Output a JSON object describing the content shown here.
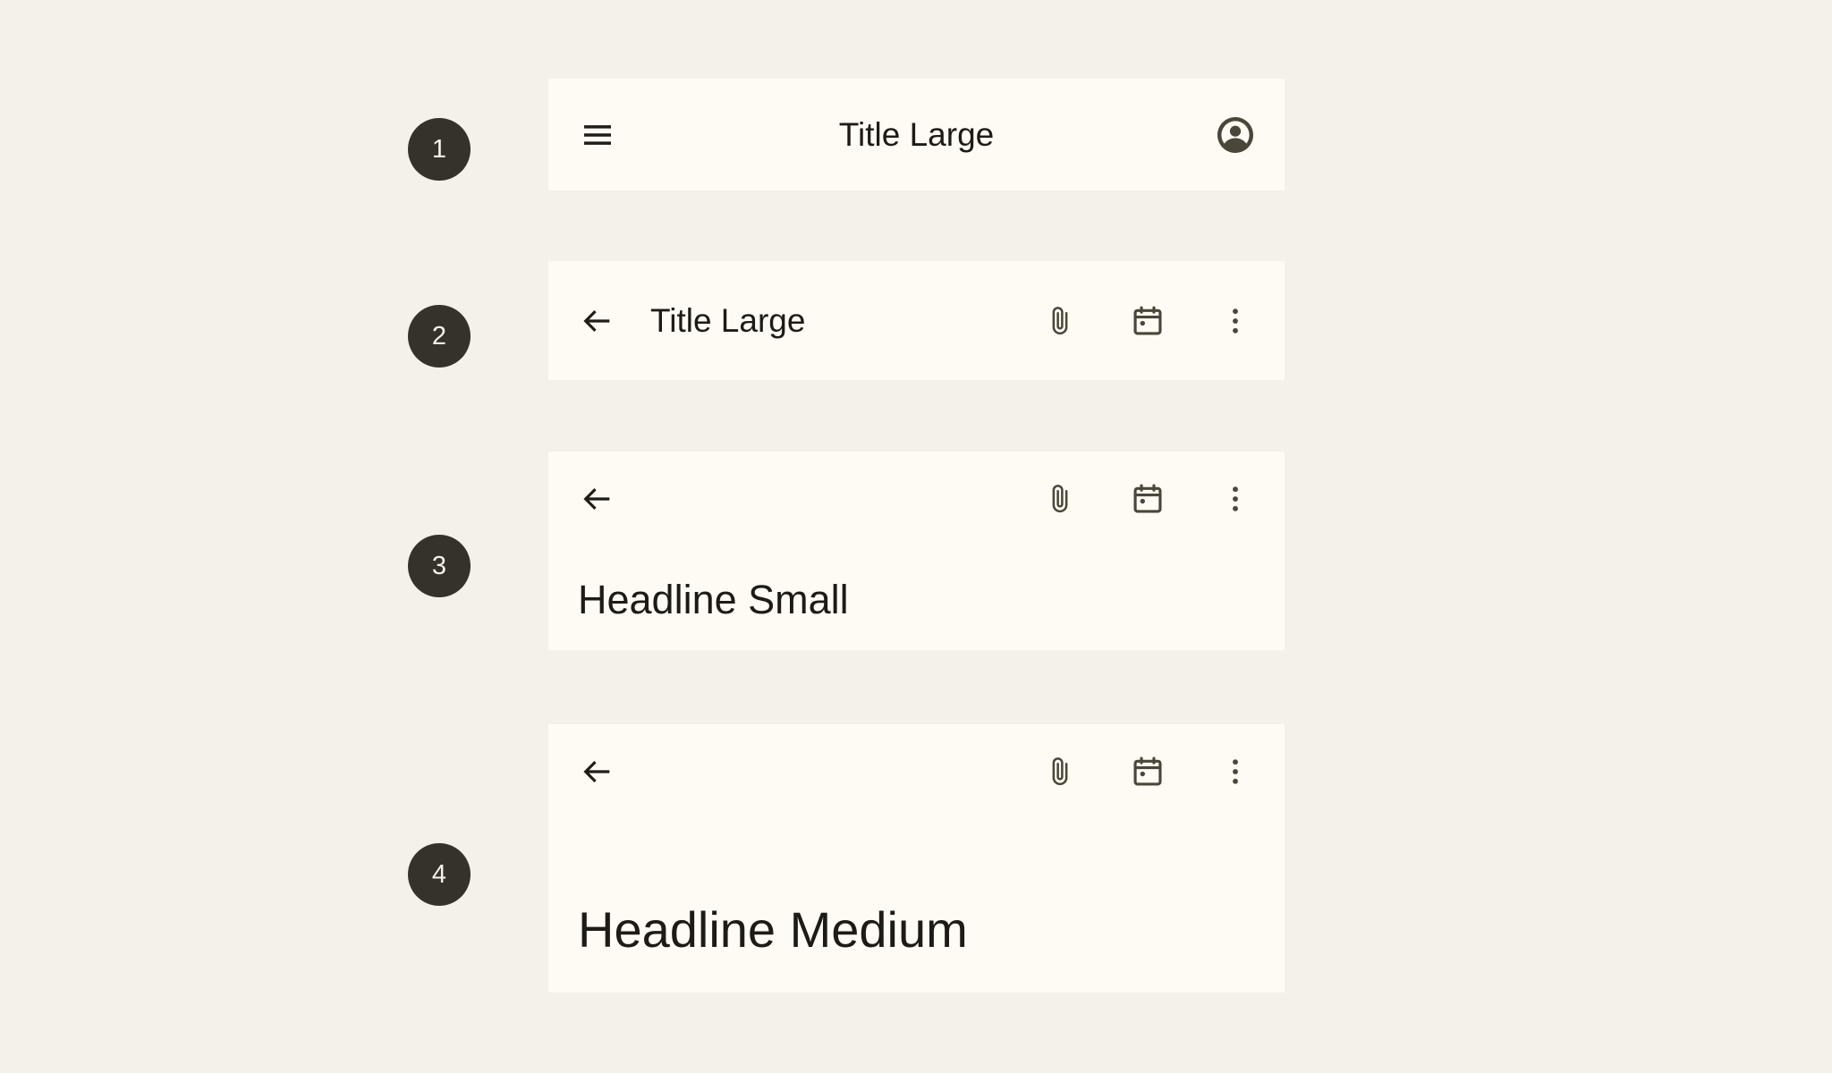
{
  "page": {
    "background_color": "#F4F1E8",
    "surface_color": "#FDFBF3",
    "on_surface_color": "#1E1B16",
    "icon_color": "#4A4639",
    "badge_color": "#35322B",
    "badge_text_color": "#F6F3EA"
  },
  "annotations": [
    {
      "number": "1"
    },
    {
      "number": "2"
    },
    {
      "number": "3"
    },
    {
      "number": "4"
    }
  ],
  "app_bars": [
    {
      "variant": "center-aligned",
      "leading_icon": "menu-icon",
      "title": "Title Large",
      "trailing_icons": [
        "account-circle-icon"
      ]
    },
    {
      "variant": "small",
      "leading_icon": "arrow-back-icon",
      "title": "Title Large",
      "trailing_icons": [
        "attachment-icon",
        "calendar-today-icon",
        "more-vert-icon"
      ]
    },
    {
      "variant": "medium",
      "leading_icon": "arrow-back-icon",
      "headline": "Headline Small",
      "trailing_icons": [
        "attachment-icon",
        "calendar-today-icon",
        "more-vert-icon"
      ]
    },
    {
      "variant": "large",
      "leading_icon": "arrow-back-icon",
      "headline": "Headline Medium",
      "trailing_icons": [
        "attachment-icon",
        "calendar-today-icon",
        "more-vert-icon"
      ]
    }
  ]
}
